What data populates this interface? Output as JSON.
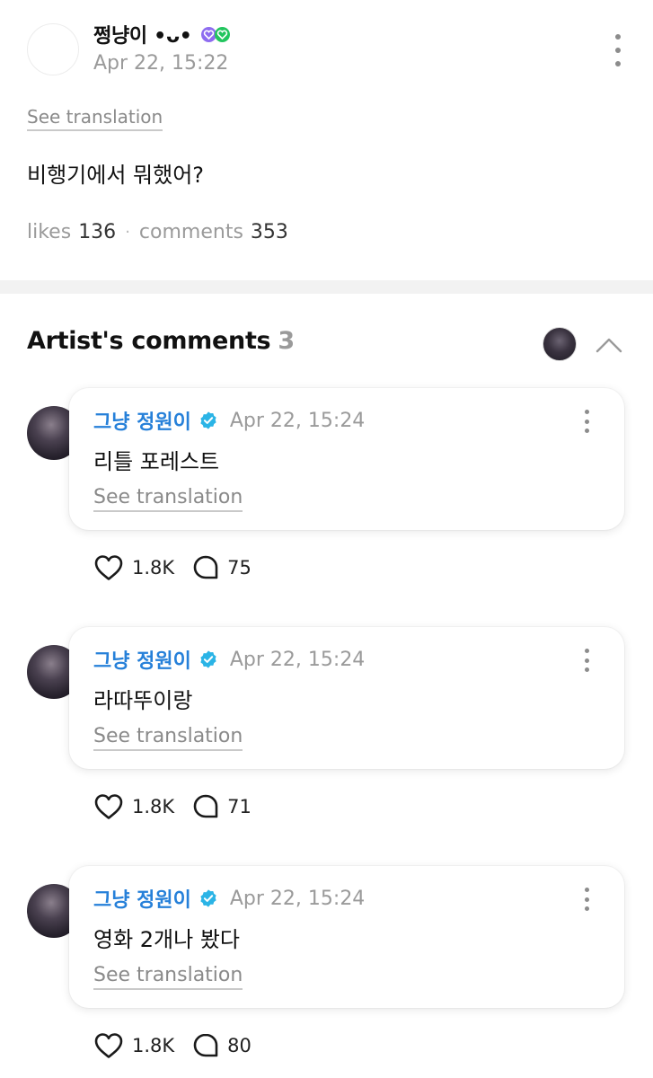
{
  "post": {
    "author": "쩡냥이 •ᴗ•",
    "date": "Apr 22, 15:22",
    "see_translation": "See translation",
    "body": "비행기에서 뭐했어?",
    "likes_label": "likes",
    "likes_count": "136",
    "separator": "·",
    "comments_label": "comments",
    "comments_count": "353"
  },
  "artist_comments": {
    "title": "Artist's comments",
    "count": "3",
    "comments": [
      {
        "author": "그냥 정원이",
        "date": "Apr 22, 15:24",
        "body": "리틀 포레스트",
        "see_translation": "See translation",
        "likes": "1.8K",
        "replies": "75"
      },
      {
        "author": "그냥 정원이",
        "date": "Apr 22, 15:24",
        "body": "라따뚜이랑",
        "see_translation": "See translation",
        "likes": "1.8K",
        "replies": "71"
      },
      {
        "author": "그냥 정원이",
        "date": "Apr 22, 15:24",
        "body": "영화 2개나 봤다",
        "see_translation": "See translation",
        "likes": "1.8K",
        "replies": "80"
      }
    ]
  },
  "icons": {
    "more": "more-vertical-icon",
    "verified": "verified-badge-icon",
    "like": "heart-icon",
    "reply": "comment-bubble-icon",
    "collapse": "chevron-up-icon"
  },
  "colors": {
    "artist_name": "#2680d9",
    "verified": "#2bb4e6",
    "muted": "#9a9a9a",
    "badge_purple": "#8e6cf0",
    "badge_green": "#22c55e"
  }
}
